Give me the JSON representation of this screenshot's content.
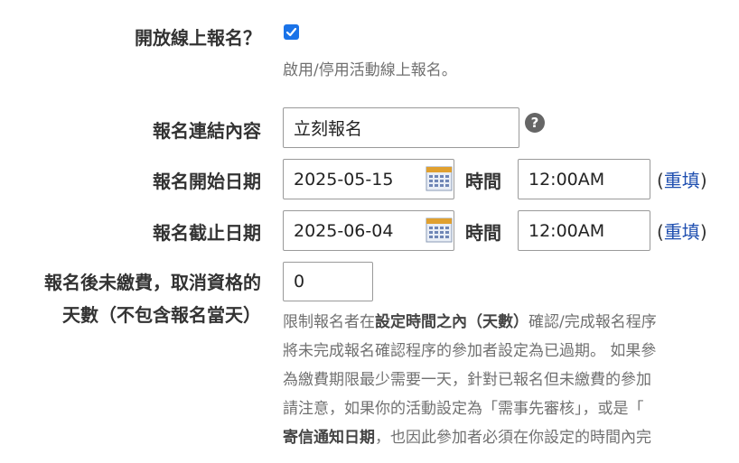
{
  "open_registration": {
    "label": "開放線上報名？",
    "checked": true,
    "help": "啟用/停用活動線上報名。"
  },
  "link_content": {
    "label": "報名連結內容",
    "value": "立刻報名",
    "help_icon": "question-circle-icon"
  },
  "start_date": {
    "label": "報名開始日期",
    "date": "2025-05-15",
    "time_label": "時間",
    "time": "12:00AM",
    "reset_open": "(",
    "reset_link": "重填",
    "reset_close": ")"
  },
  "end_date": {
    "label": "報名截止日期",
    "date": "2025-06-04",
    "time_label": "時間",
    "time": "12:00AM",
    "reset_open": "(",
    "reset_link": "重填",
    "reset_close": ")"
  },
  "unpaid_cancel": {
    "label_line1": "報名後未繳費，取消資格的",
    "label_line2": "天數（不包含報名當天）",
    "value": "0",
    "description": {
      "l1_a": "限制報名者在",
      "l1_b": "設定時間之內（天數）",
      "l1_c": "確認/完成報名程序",
      "l2": "將未完成報名確認程序的參加者設定為已過期。 如果參",
      "l3": "為繳費期限最少需要一天，針對已報名但未繳費的參加",
      "l4": "請注意，如果你的活動設定為「需事先審核」，或是「",
      "l5_a": "寄信通知日期",
      "l5_b": "，也因此參加者必須在你設定的時間內完"
    }
  },
  "colors": {
    "accent": "#1a73e8",
    "link": "#1f4fb0",
    "muted": "#707070"
  }
}
